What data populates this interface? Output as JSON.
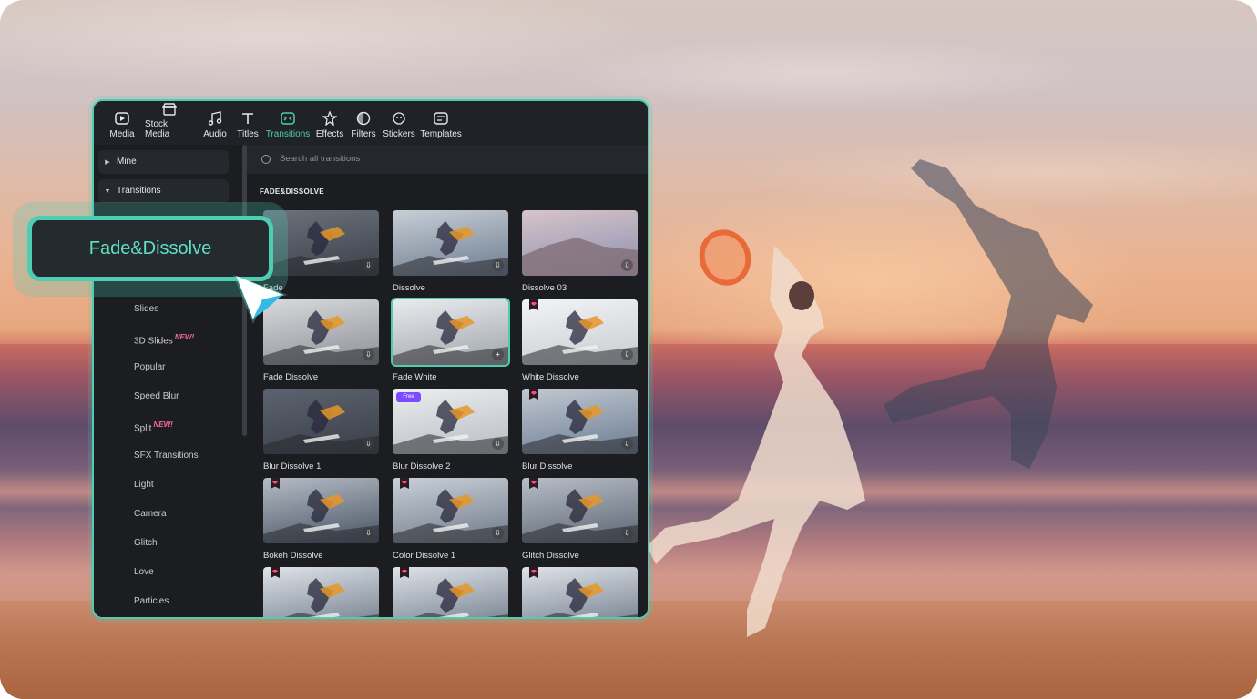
{
  "topnav": [
    {
      "label": "Media",
      "icon": "media-icon"
    },
    {
      "label": "Stock Media",
      "icon": "stock-media-icon"
    },
    {
      "label": "Audio",
      "icon": "audio-icon"
    },
    {
      "label": "Titles",
      "icon": "titles-icon"
    },
    {
      "label": "Transitions",
      "icon": "transitions-icon",
      "active": true
    },
    {
      "label": "Effects",
      "icon": "effects-icon"
    },
    {
      "label": "Filters",
      "icon": "filters-icon"
    },
    {
      "label": "Stickers",
      "icon": "stickers-icon"
    },
    {
      "label": "Templates",
      "icon": "templates-icon"
    }
  ],
  "sidebar": {
    "mine": "Mine",
    "transitions": "Transitions",
    "items": [
      "Slides",
      "3D Slides",
      "Popular",
      "Speed Blur",
      "Split",
      "SFX Transitions",
      "Light",
      "Camera",
      "Glitch",
      "Love",
      "Particles"
    ],
    "new_badge": "NEW!"
  },
  "search": {
    "placeholder": "Search all transitions"
  },
  "section_title": "FADE&DISSOLVE",
  "callout": "Fade&Dissolve",
  "cards": [
    {
      "label": "Fade",
      "badge": ""
    },
    {
      "label": "Dissolve",
      "badge": ""
    },
    {
      "label": "Dissolve 03",
      "badge": ""
    },
    {
      "label": "Fade Dissolve",
      "badge": ""
    },
    {
      "label": "Fade White",
      "badge": "",
      "selected": true
    },
    {
      "label": "White Dissolve",
      "badge": "premium"
    },
    {
      "label": "Blur Dissolve 1",
      "badge": ""
    },
    {
      "label": "Blur Dissolve 2",
      "badge": "free",
      "free_text": "Free"
    },
    {
      "label": "Blur Dissolve",
      "badge": "premium"
    },
    {
      "label": "Bokeh Dissolve",
      "badge": "premium"
    },
    {
      "label": "Color Dissolve 1",
      "badge": "premium"
    },
    {
      "label": "Glitch Dissolve",
      "badge": "premium"
    },
    {
      "label": "",
      "badge": "premium"
    },
    {
      "label": "",
      "badge": "premium"
    },
    {
      "label": "",
      "badge": "premium"
    }
  ],
  "colors": {
    "accent": "#4ecdb3",
    "panel": "#1b1d21",
    "premium": "#ff4d7a"
  }
}
